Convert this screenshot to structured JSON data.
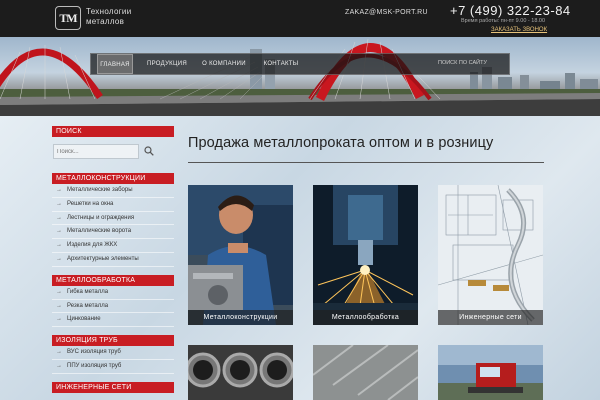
{
  "header": {
    "logo_mark": "ТМ",
    "logo_line1": "Технологии",
    "logo_line2": "металлов",
    "email": "ZAKAZ@MSK-PORT.RU",
    "phone": "+7 (499) 322-23-84",
    "hours": "Время работы: пн-пт 9.00 - 18.00",
    "callback": "ЗАКАЗАТЬ ЗВОНОК"
  },
  "nav": {
    "items": [
      {
        "label": "ГЛАВНАЯ",
        "active": true
      },
      {
        "label": "ПРОДУКЦИЯ",
        "active": false
      },
      {
        "label": "О КОМПАНИИ",
        "active": false
      },
      {
        "label": "КОНТАКТЫ",
        "active": false
      }
    ],
    "search_label": "ПОИСК ПО САЙТУ"
  },
  "sidebar": {
    "search_head": "ПОИСК",
    "search_placeholder": "Поиск...",
    "sections": [
      {
        "title": "МЕТАЛЛОКОНСТРУКЦИИ",
        "items": [
          "Металлические заборы",
          "Решетки на окна",
          "Лестницы и ограждения",
          "Металлические ворота",
          "Изделия для ЖКХ",
          "Архитектурные элементы"
        ]
      },
      {
        "title": "МЕТАЛЛООБРАБОТКА",
        "items": [
          "Гибка металла",
          "Резка металла",
          "Цинкование"
        ]
      },
      {
        "title": "ИЗОЛЯЦИЯ ТРУБ",
        "items": [
          "ВУС изоляция труб",
          "ППУ изоляция труб"
        ]
      },
      {
        "title": "ИНЖЕНЕРНЫЕ СЕТИ",
        "items": []
      }
    ]
  },
  "main": {
    "title": "Продажа металлопроката оптом и в розницу",
    "tiles": [
      {
        "caption": "Металлоконструкции"
      },
      {
        "caption": "Металлообработка"
      },
      {
        "caption": "Инженерные сети"
      }
    ]
  },
  "colors": {
    "accent_red": "#c81d23",
    "header_bg": "#1c1c1c",
    "callback": "#e8c37a"
  }
}
